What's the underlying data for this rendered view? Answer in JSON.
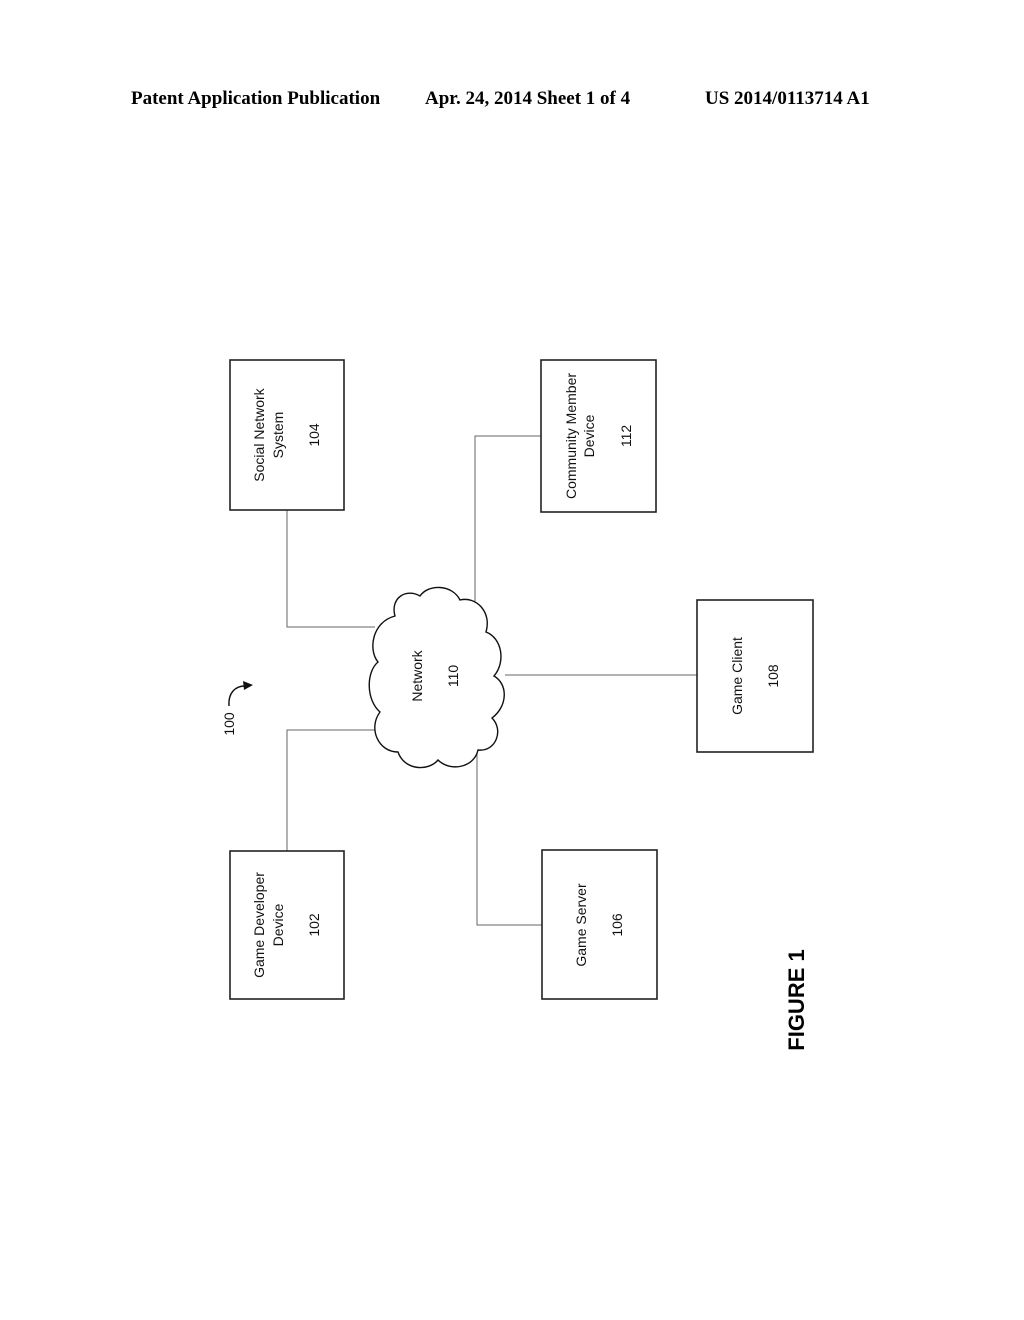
{
  "header": {
    "publication": "Patent Application Publication",
    "date_sheet": "Apr. 24, 2014  Sheet 1 of 4",
    "number": "US 2014/0113714 A1"
  },
  "diagram": {
    "system_ref": "100",
    "network": {
      "label": "Network",
      "ref": "110"
    },
    "nodes": {
      "social_network": {
        "line1": "Social Network",
        "line2": "System",
        "ref": "104"
      },
      "community_member": {
        "line1": "Community Member",
        "line2": "Device",
        "ref": "112"
      },
      "game_client": {
        "line1": "Game Client",
        "ref": "108"
      },
      "game_developer": {
        "line1": "Game Developer",
        "line2": "Device",
        "ref": "102"
      },
      "game_server": {
        "line1": "Game Server",
        "ref": "106"
      }
    },
    "connections": [
      [
        "network",
        "social_network"
      ],
      [
        "network",
        "community_member"
      ],
      [
        "network",
        "game_client"
      ],
      [
        "network",
        "game_developer"
      ],
      [
        "network",
        "game_server"
      ]
    ]
  },
  "figure_label": "FIGURE 1"
}
